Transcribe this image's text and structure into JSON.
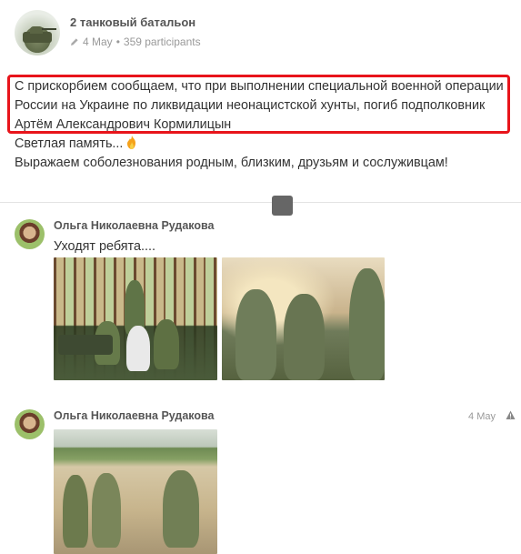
{
  "post": {
    "group_name": "2 танковый батальон",
    "date": "4 May",
    "separator": "•",
    "participants": "359 participants",
    "lines": [
      "С прискорбием сообщаем, что при выполнении специальной военной операции",
      "России на Украине по ликвидации неонацистской хунты, погиб подполковник",
      "Артём Александрович Кормилицын",
      "Светлая память...",
      "Выражаем соболезнования родным, близким, друзьям и сослуживцам!"
    ],
    "highlight_color": "#e8141b"
  },
  "comments": [
    {
      "author": "Ольга Николаевна Рудакова",
      "text": "Уходят ребята....",
      "date": "",
      "photos": [
        "forest-group-photo",
        "tent-soldiers-photo"
      ]
    },
    {
      "author": "Ольга Николаевна Рудакова",
      "text": "",
      "date": "4 May",
      "photos": [
        "field-soldiers-photo"
      ]
    }
  ],
  "icons": {
    "edit": "pencil-icon",
    "candle": "fire-icon",
    "report": "alert-icon"
  }
}
